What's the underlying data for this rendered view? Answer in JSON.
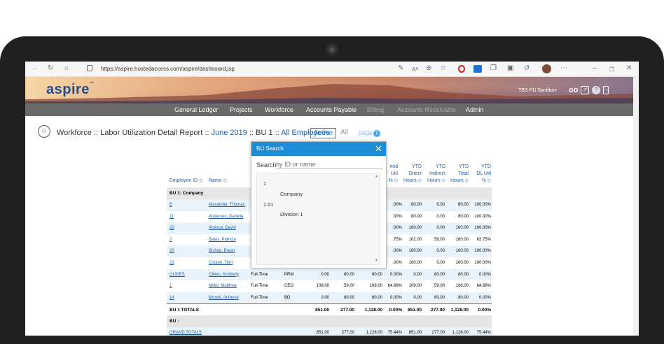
{
  "browser": {
    "url": "https://aspire.hostedaccess.com/aspire/dashboard.jsp"
  },
  "header": {
    "logo": "aspire",
    "logo_tm": "™",
    "sandbox_label": "TBS PD Sandbox"
  },
  "nav": {
    "items": [
      {
        "label": "General Ledger",
        "enabled": true
      },
      {
        "label": "Projects",
        "enabled": true
      },
      {
        "label": "Workforce",
        "enabled": true
      },
      {
        "label": "Accounts Payable",
        "enabled": true
      },
      {
        "label": "Billing",
        "enabled": false
      },
      {
        "label": "Accounts Receivable",
        "enabled": false
      },
      {
        "label": "Admin",
        "enabled": true
      }
    ]
  },
  "page": {
    "title_prefix": "Workforce :: Labor Utilization Detail Report ::",
    "period": "June 2019",
    "sep1": ":: BU 1 ::",
    "employees_link": "All Employees",
    "active_btn": "Active",
    "all_btn": "All",
    "page_label": "page",
    "page_number": "1"
  },
  "table": {
    "headers": {
      "employee_id": "Employee ID ◇",
      "name": "Name ◇",
      "period_util": "riod\nUtil\n% ◇",
      "ytd_direct": "YTD\nDirect\nHours ◇",
      "ytd_indirect": "YTD\nIndirect\nHours ◇",
      "ytd_total": "YTD\nTotal\nHours ◇",
      "ytd_dl_util": "YTD\nDL Util\n% ◇"
    },
    "group_label": "BU 1: Company",
    "rows": [
      {
        "id": "8",
        "name": "Alexander, Thomas",
        "type": "",
        "cat": "",
        "d": "",
        "i": "",
        "t": "",
        "u": ".00%",
        "yd": "80.00",
        "yi": "0.00",
        "yt": "80.00",
        "yu": "100.00%"
      },
      {
        "id": "11",
        "name": "Andersen, Danella",
        "type": "",
        "cat": "",
        "d": "",
        "i": "",
        "t": "",
        "u": ".00%",
        "yd": "80.00",
        "yi": "0.00",
        "yt": "80.00",
        "yu": "100.00%"
      },
      {
        "id": "22",
        "name": "Atwood, David",
        "type": "",
        "cat": "",
        "d": "",
        "i": "",
        "t": "",
        "u": ".00%",
        "yd": "160.00",
        "yi": "0.00",
        "yt": "160.00",
        "yu": "100.00%"
      },
      {
        "id": "2",
        "name": "Bates, Patricia",
        "type": "",
        "cat": "",
        "d": "",
        "i": "",
        "t": "",
        "u": ".75%",
        "yd": "102.00",
        "yi": "58.00",
        "yt": "160.00",
        "yu": "63.75%"
      },
      {
        "id": "20",
        "name": "Bishop, Bryan",
        "type": "",
        "cat": "",
        "d": "",
        "i": "",
        "t": "",
        "u": ".00%",
        "yd": "160.00",
        "yi": "0.00",
        "yt": "160.00",
        "yu": "100.00%"
      },
      {
        "id": "23",
        "name": "Cooper, Terri",
        "type": "",
        "cat": "",
        "d": "",
        "i": "",
        "t": "",
        "u": ".00%",
        "yd": "160.00",
        "yi": "0.00",
        "yt": "160.00",
        "yu": "100.00%"
      },
      {
        "id": "GLIKES",
        "name": "Glikes, Kimberly",
        "type": "Full-Time",
        "cat": "PRM",
        "d": "0.00",
        "i": "80.00",
        "t": "80.00",
        "u": "0.00%",
        "yd": "0.00",
        "yi": "80.00",
        "yt": "80.00",
        "yu": "0.00%"
      },
      {
        "id": "1",
        "name": "Miller, Matthew",
        "type": "Full-Time",
        "cat": "CEO",
        "d": "109.00",
        "i": "59.00",
        "t": "168.00",
        "u": "64.88%",
        "yd": "109.00",
        "yi": "59.00",
        "yt": "168.00",
        "yu": "64.88%"
      },
      {
        "id": "14",
        "name": "Morelli, Anthony",
        "type": "Full-Time",
        "cat": "BD",
        "d": "0.00",
        "i": "80.00",
        "t": "80.00",
        "u": "0.00%",
        "yd": "0.00",
        "yi": "80.00",
        "yt": "80.00",
        "yu": "0.00%"
      }
    ],
    "bu_total": {
      "label": "BU 1 TOTALS",
      "d": "851.00",
      "i": "277.00",
      "t": "1,128.00",
      "u": "0.00%",
      "yd": "851.00",
      "yi": "277.00",
      "yt": "1,128.00",
      "yu": "0.00%"
    },
    "bu_blank_label": "BU :",
    "grand_total": {
      "label": "GRAND TOTALS",
      "d": "851.00",
      "i": "277.00",
      "t": "1,128.00",
      "u": "75.44%",
      "yd": "851.00",
      "yi": "277.00",
      "yt": "1,128.00",
      "yu": "75.44%"
    }
  },
  "bu_search": {
    "title": "BU Search",
    "search_label": "Search",
    "search_placeholder": "by ID or name",
    "items": [
      {
        "id": "1",
        "name": "Company"
      },
      {
        "id": "1.01",
        "name": "Division 1"
      }
    ]
  },
  "colors": {
    "accent": "#1e8dd6",
    "link": "#1e5fae",
    "nav_bg": "#6a6a6a",
    "row_alt": "#e9f3fb"
  }
}
